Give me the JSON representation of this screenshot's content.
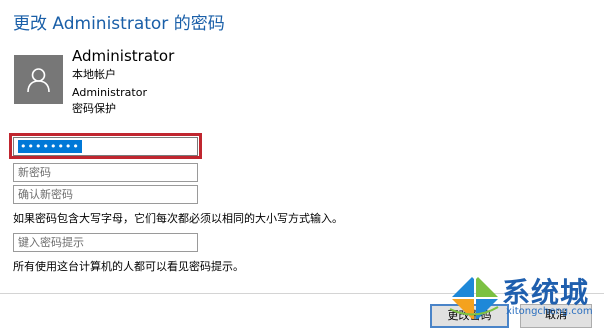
{
  "title": "更改 Administrator 的密码",
  "user": {
    "name": "Administrator",
    "account_type": "本地帐户",
    "account_name": "Administrator",
    "protection": "密码保护"
  },
  "fields": {
    "current_password_value": "••••••••",
    "new_password_placeholder": "新密码",
    "confirm_password_placeholder": "确认新密码",
    "hint_placeholder": "键入密码提示"
  },
  "notes": {
    "case_notice": "如果密码包含大写字母，它们每次都必须以相同的大小写方式输入。",
    "hint_notice": "所有使用这台计算机的人都可以看见密码提示。"
  },
  "buttons": {
    "save": "更改密码",
    "cancel": "取消"
  },
  "watermark": {
    "text": "系统城",
    "sub": "xitongcheng.com"
  },
  "colors": {
    "title": "#1a5fa8",
    "highlight_box": "#c0262f",
    "selection": "#0078d7"
  }
}
